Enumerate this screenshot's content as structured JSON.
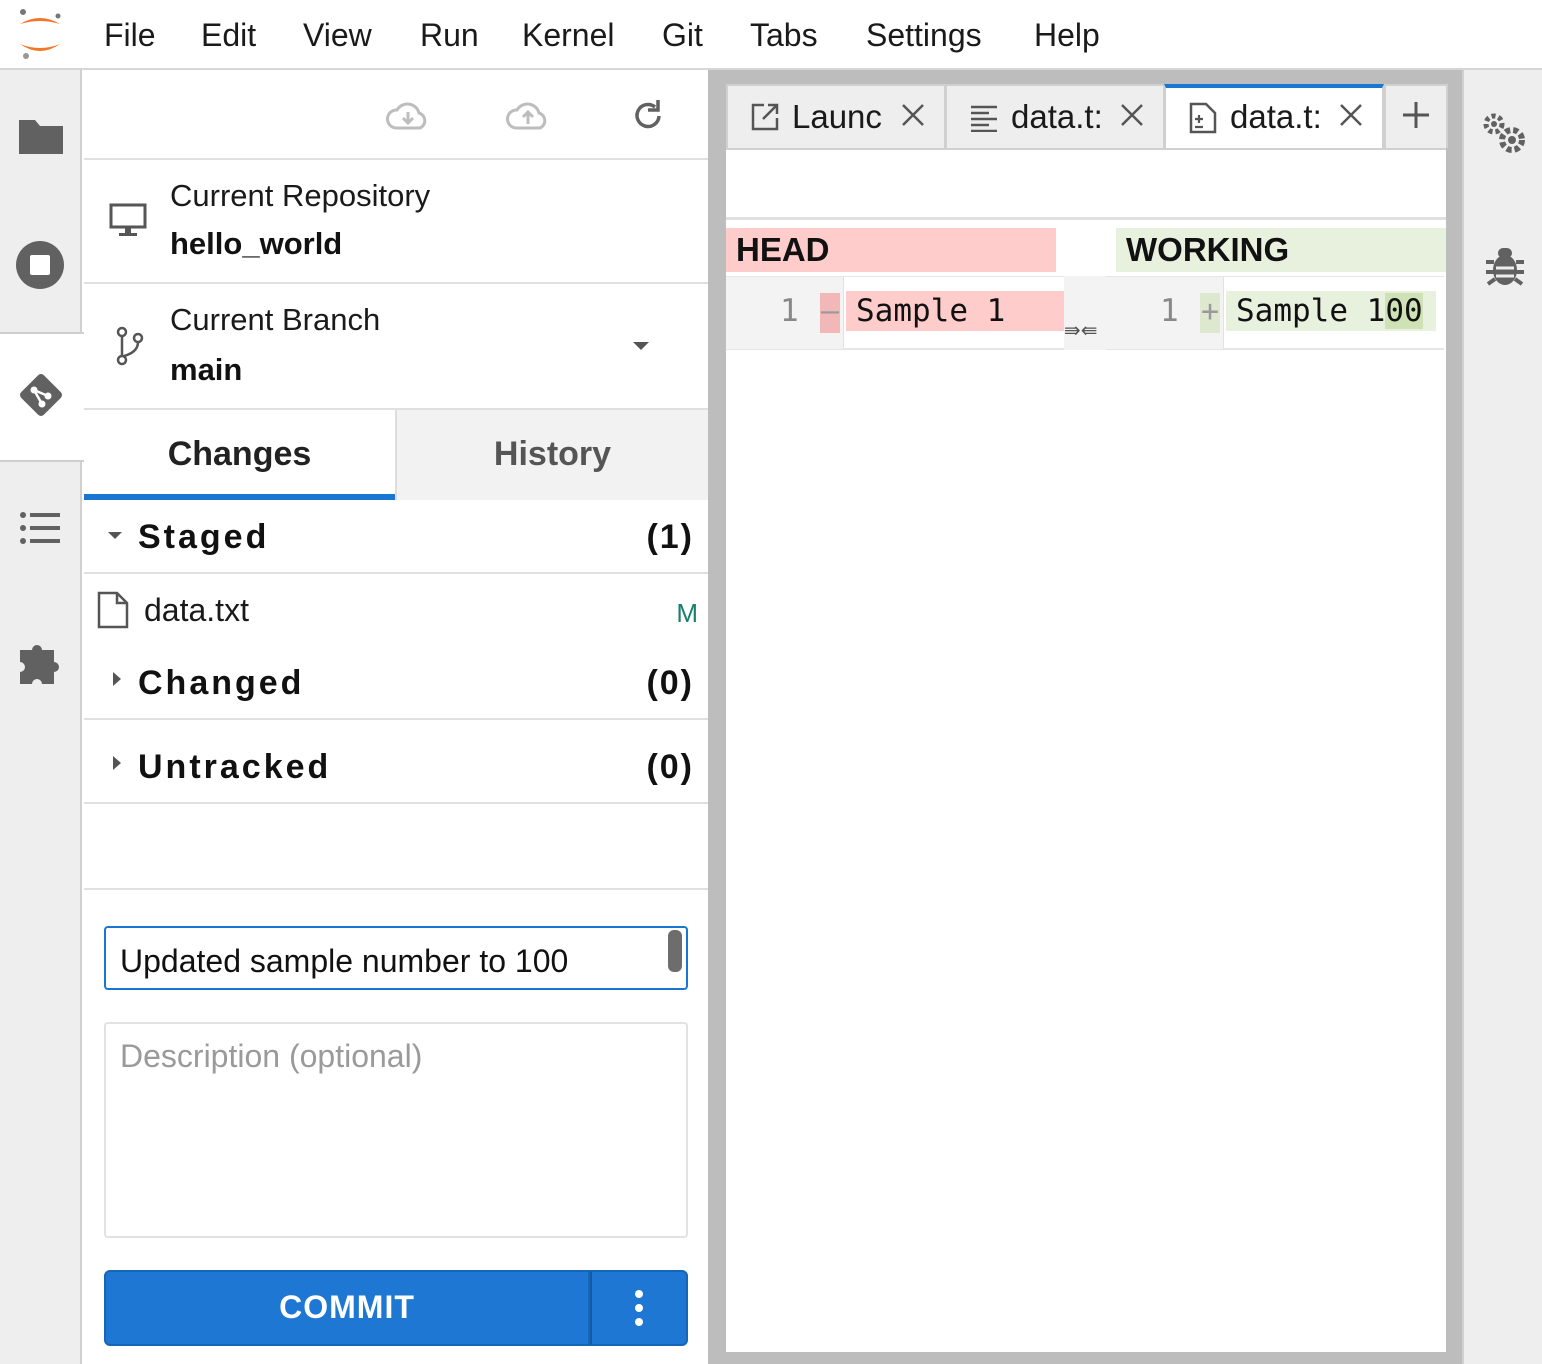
{
  "menubar": {
    "items": [
      "File",
      "Edit",
      "View",
      "Run",
      "Kernel",
      "Git",
      "Tabs",
      "Settings",
      "Help"
    ]
  },
  "leftbar": {
    "icons": [
      "folder-icon",
      "stop-circle-icon",
      "git-icon",
      "list-icon",
      "puzzle-icon"
    ],
    "active": "git-icon"
  },
  "git_panel": {
    "toolbar": {
      "icons": [
        "cloud-download-icon",
        "cloud-upload-icon",
        "refresh-icon"
      ]
    },
    "repository": {
      "label": "Current Repository",
      "value": "hello_world"
    },
    "branch": {
      "label": "Current Branch",
      "value": "main"
    },
    "tabs": [
      {
        "label": "Changes",
        "active": true
      },
      {
        "label": "History",
        "active": false
      }
    ],
    "sections": {
      "staged": {
        "title": "Staged",
        "count": "(1)",
        "expanded": true,
        "files": [
          {
            "name": "data.txt",
            "status": "M"
          }
        ]
      },
      "changed": {
        "title": "Changed",
        "count": "(0)",
        "expanded": false
      },
      "untracked": {
        "title": "Untracked",
        "count": "(0)",
        "expanded": false
      }
    },
    "commit": {
      "summary_value": "Updated sample number to 100",
      "description_placeholder": "Description (optional)",
      "button_label": "COMMIT"
    }
  },
  "document_tabs": [
    {
      "label": "Launc",
      "icon": "launch-icon",
      "active": false
    },
    {
      "label": "data.t:",
      "icon": "text-file-icon",
      "active": false
    },
    {
      "label": "data.t:",
      "icon": "diff-file-icon",
      "active": true
    }
  ],
  "diff": {
    "head_label": "HEAD",
    "working_label": "WORKING",
    "left": {
      "line_number": "1",
      "marker": "–",
      "text": "Sample 1"
    },
    "right": {
      "line_number": "1",
      "marker": "+",
      "text_prefix": "Sample 1",
      "text_changed": "00"
    },
    "merge_arrows": "⇛⇚"
  },
  "rightbar": {
    "icons": [
      "property-inspector-gears-icon",
      "debugger-bug-icon"
    ]
  },
  "colors": {
    "accent": "#1976d2",
    "head_bg": "#ffcccc",
    "working_bg": "#e8f0de",
    "modified_status": "#1a7f6e",
    "logo_orange": "#f37726"
  }
}
